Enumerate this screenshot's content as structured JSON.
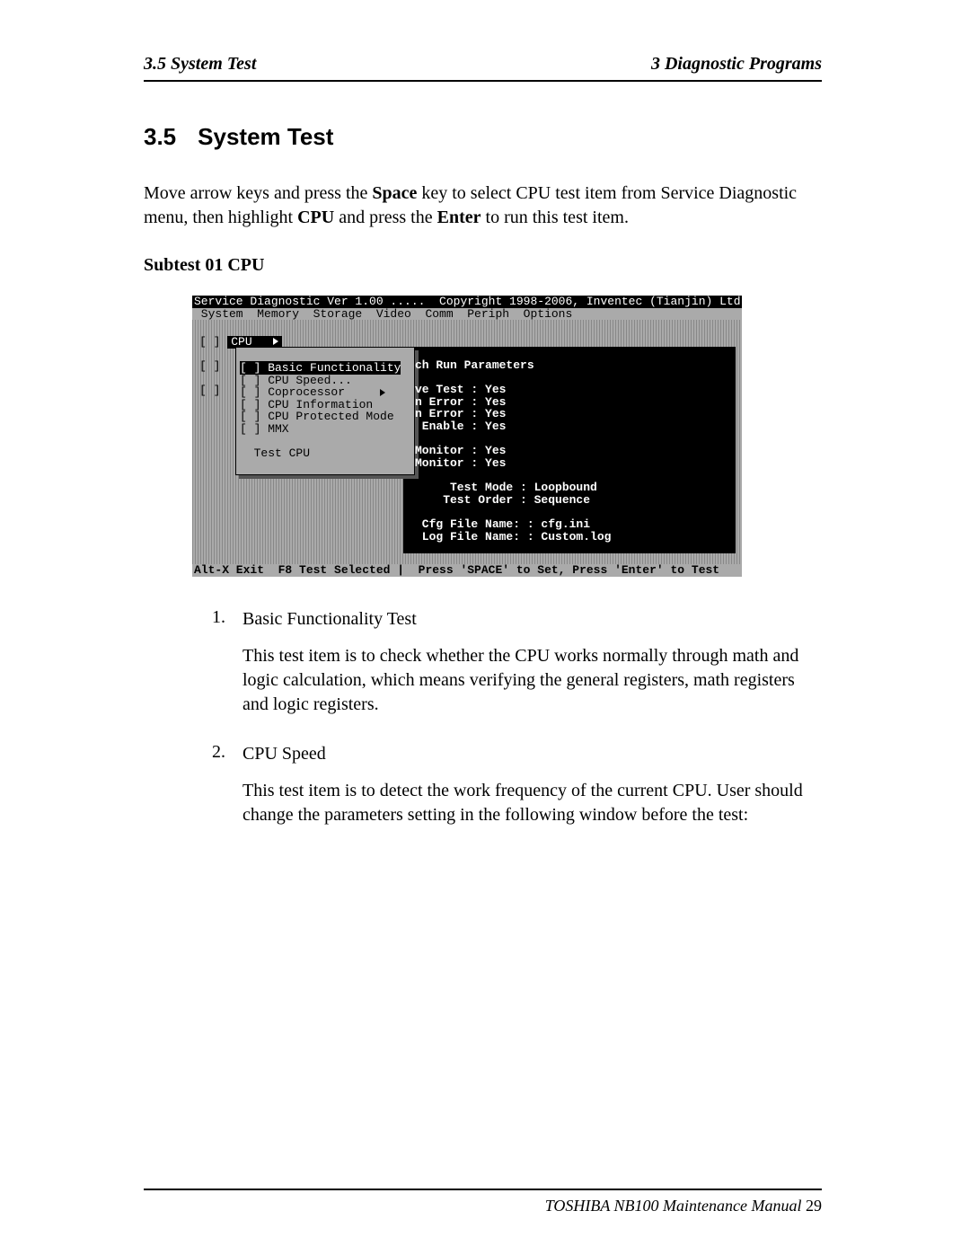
{
  "header": {
    "left": "3.5 System Test",
    "right": "3  Diagnostic Programs"
  },
  "section": {
    "number": "3.5",
    "title": "System Test"
  },
  "intro": {
    "t1": "Move arrow keys and press the ",
    "b1": "Space",
    "t2": " key to select CPU test item from Service Diagnostic menu, then highlight ",
    "b2": "CPU",
    "t3": " and press the ",
    "b3": "Enter",
    "t4": " to run this test item."
  },
  "subtest": "Subtest 01 CPU",
  "shot": {
    "title": "Service Diagnostic Ver 1.00 .....  Copyright 1998-2006, Inventec (Tianjin) Ltd.",
    "menu": " System  Memory  Storage  Video  Comm  Periph  Options",
    "leftcol": "[ ]\n[ ]\n[ ]",
    "cpu_label": "CPU",
    "submenu": {
      "i1": "[ ] Basic Functionality",
      "i2": "[ ] CPU Speed...",
      "i3": "[ ] Coprocessor",
      "i4": "[ ] CPU Information",
      "i5": "[ ] CPU Protected Mode",
      "i6": "[ ] MMX",
      "i7": "  Test CPU"
    },
    "params": {
      "hdr": "ch Run Parameters",
      "l1": "ve Test : Yes",
      "l2": "n Error : Yes",
      "l3": "n Error : Yes",
      "l4": " Enable : Yes",
      "l5": "Monitor : Yes",
      "l6": "Monitor : Yes",
      "l7": "     Test Mode : Loopbound",
      "l8": "    Test Order : Sequence",
      "l9": " Cfg File Name: : cfg.ini",
      "l10": " Log File Name: : Custom.log"
    },
    "footer": "Alt-X Exit  F8 Test Selected |  Press 'SPACE' to Set, Press 'Enter' to Test"
  },
  "list": {
    "i1": {
      "num": "1.",
      "title": "Basic Functionality Test",
      "body": "This test item is to check whether the CPU works normally through math and logic calculation, which means verifying the general registers, math registers and logic registers."
    },
    "i2": {
      "num": "2.",
      "title": "CPU Speed",
      "body": "This test item is to detect the work frequency of the current CPU. User should change the parameters setting in the following window before the test:"
    }
  },
  "footer": {
    "text": "TOSHIBA NB100 Maintenance Manual ",
    "page": "29"
  }
}
